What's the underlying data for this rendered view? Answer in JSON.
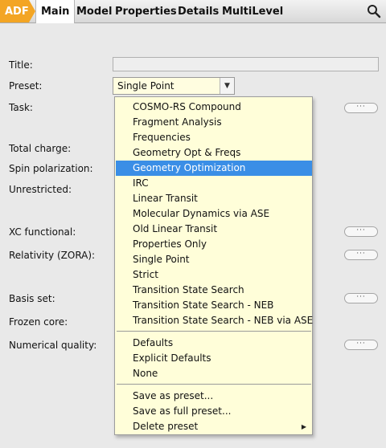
{
  "tabs": {
    "adf": "ADF",
    "main": "Main",
    "model": "Model",
    "properties": "Properties",
    "details": "Details",
    "multilevel": "MultiLevel"
  },
  "form": {
    "title_label": "Title:",
    "title_value": "",
    "preset_label": "Preset:",
    "preset_value": "Single Point",
    "task_label": "Task:",
    "total_charge_label": "Total charge:",
    "spin_polarization_label": "Spin polarization:",
    "unrestricted_label": "Unrestricted:",
    "xc_functional_label": "XC functional:",
    "relativity_label": "Relativity (ZORA):",
    "basis_set_label": "Basis set:",
    "frozen_core_label": "Frozen core:",
    "numerical_quality_label": "Numerical quality:",
    "more_button": "···"
  },
  "menu": {
    "tasks": [
      "COSMO-RS Compound",
      "Fragment Analysis",
      "Frequencies",
      "Geometry Opt & Freqs",
      "Geometry Optimization",
      "IRC",
      "Linear Transit",
      "Molecular Dynamics via ASE",
      "Old Linear Transit",
      "Properties Only",
      "Single Point",
      "Strict",
      "Transition State Search",
      "Transition State Search - NEB",
      "Transition State Search - NEB via ASE"
    ],
    "selected": "Geometry Optimization",
    "defaults": [
      "Defaults",
      "Explicit Defaults",
      "None"
    ],
    "actions": [
      "Save as preset...",
      "Save as full preset...",
      "Delete preset"
    ]
  },
  "colors": {
    "adf_tab": "#f3a524",
    "menu_background": "#fffed9",
    "selection": "#3a8ee6"
  },
  "icons": {
    "search": "search-icon",
    "dropdown": "chevron-down-icon",
    "submenu": "chevron-right-icon"
  }
}
